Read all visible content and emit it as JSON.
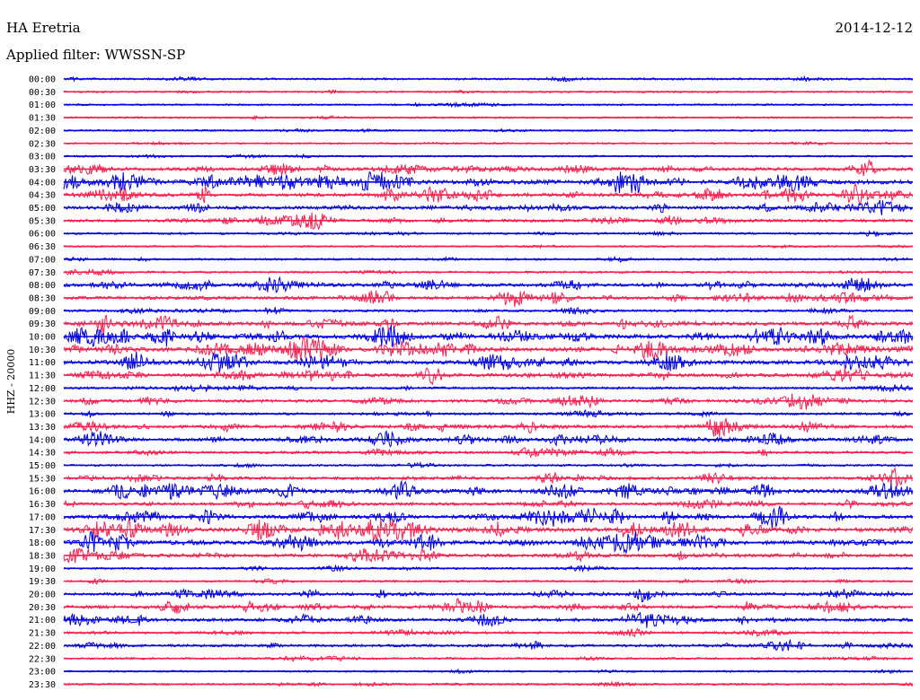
{
  "header": {
    "station": "HA Eretria",
    "date": "2014-12-12",
    "filter": "Applied filter: WWSSN-SP"
  },
  "chart_data": {
    "type": "line",
    "title": "HA Eretria",
    "subtitle": "Applied filter: WWSSN-SP",
    "date": "2014-12-12",
    "ylabel": "HHZ - 20000",
    "xlabel": "",
    "colors": [
      "#0000e6",
      "#ff1f4f"
    ],
    "rows": [
      "00:00",
      "00:30",
      "01:00",
      "01:30",
      "02:00",
      "02:30",
      "03:00",
      "03:30",
      "04:00",
      "04:30",
      "05:00",
      "05:30",
      "06:00",
      "06:30",
      "07:00",
      "07:30",
      "08:00",
      "08:30",
      "09:00",
      "09:30",
      "10:00",
      "10:30",
      "11:00",
      "11:30",
      "12:00",
      "12:30",
      "13:00",
      "13:30",
      "14:00",
      "14:30",
      "15:00",
      "15:30",
      "16:00",
      "16:30",
      "17:00",
      "17:30",
      "18:00",
      "18:30",
      "19:00",
      "19:30",
      "20:00",
      "20:30",
      "21:00",
      "21:30",
      "22:00",
      "22:30",
      "23:00",
      "23:30"
    ],
    "activity": [
      2,
      1,
      1,
      1,
      1,
      1,
      1,
      6,
      9,
      7,
      6,
      5,
      2,
      1,
      2,
      2,
      6,
      6,
      3,
      7,
      9,
      9,
      8,
      7,
      3,
      5,
      3,
      6,
      6,
      4,
      2,
      5,
      8,
      5,
      7,
      9,
      8,
      6,
      2,
      2,
      5,
      6,
      6,
      3,
      4,
      2,
      1,
      2
    ]
  }
}
